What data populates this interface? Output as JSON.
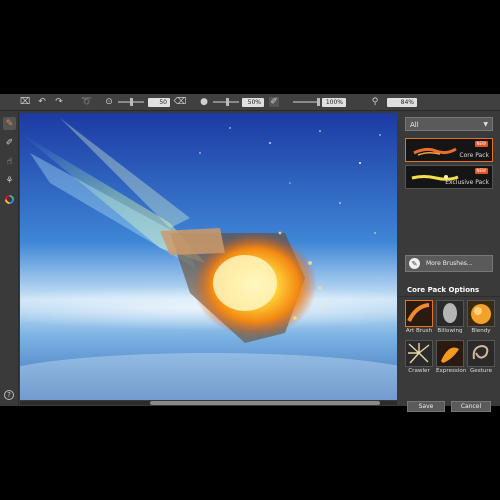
{
  "toolbar": {
    "brush_size_value": "50",
    "opacity_value": "50%",
    "flow_value": "100%",
    "zoom_value": "84%",
    "icons": [
      "crop-icon",
      "undo-icon",
      "redo-icon",
      "lasso-icon",
      "brush-size-icon",
      "brush-tip-icon",
      "opacity-icon",
      "brush-flow-icon",
      "zoom-icon"
    ]
  },
  "left_tools": [
    "brush-icon",
    "eraser-icon",
    "smudge-icon",
    "eyedropper-icon",
    "color-wheel-icon"
  ],
  "help_label": "?",
  "right_panel": {
    "filter_selected": "All",
    "packs": [
      {
        "name": "Core Pack",
        "badge": "NEW"
      },
      {
        "name": "Exclusive Pack",
        "badge": "NEW"
      }
    ],
    "more_brushes_label": "More Brushes...",
    "options_title": "Core Pack Options",
    "brushes": [
      "Art Brush",
      "Billowing",
      "Blendy",
      "Crawler",
      "Expression",
      "Gesture"
    ],
    "save_label": "Save",
    "cancel_label": "Cancel"
  },
  "colors": {
    "accent": "#e5731f",
    "panel": "#3a3a3a",
    "toolbar": "#404040"
  }
}
